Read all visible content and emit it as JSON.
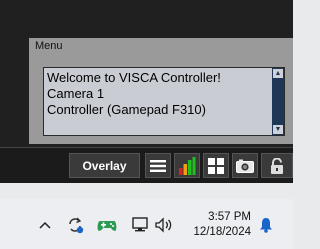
{
  "menu": {
    "title": "Menu",
    "lines": [
      "Welcome to VISCA Controller!",
      "Camera 1",
      "Controller (Gamepad F310)"
    ]
  },
  "toolbar": {
    "overlay_label": "Overlay",
    "icons": [
      "menu-icon",
      "signal-bars-icon",
      "grid-icon",
      "camera-icon",
      "lock-icon"
    ]
  },
  "taskbar": {
    "time": "3:57 PM",
    "date": "12/18/2024",
    "icons": [
      "chevron-up-icon",
      "sync-icon",
      "gamepad-icon",
      "network-icon",
      "volume-icon",
      "notification-bell-icon"
    ]
  },
  "colors": {
    "scrollbar": "#1f3756",
    "bar_red": "#e02020",
    "bar_orange": "#f0a010",
    "bar_green": "#20c020",
    "bell": "#1a66c8"
  }
}
